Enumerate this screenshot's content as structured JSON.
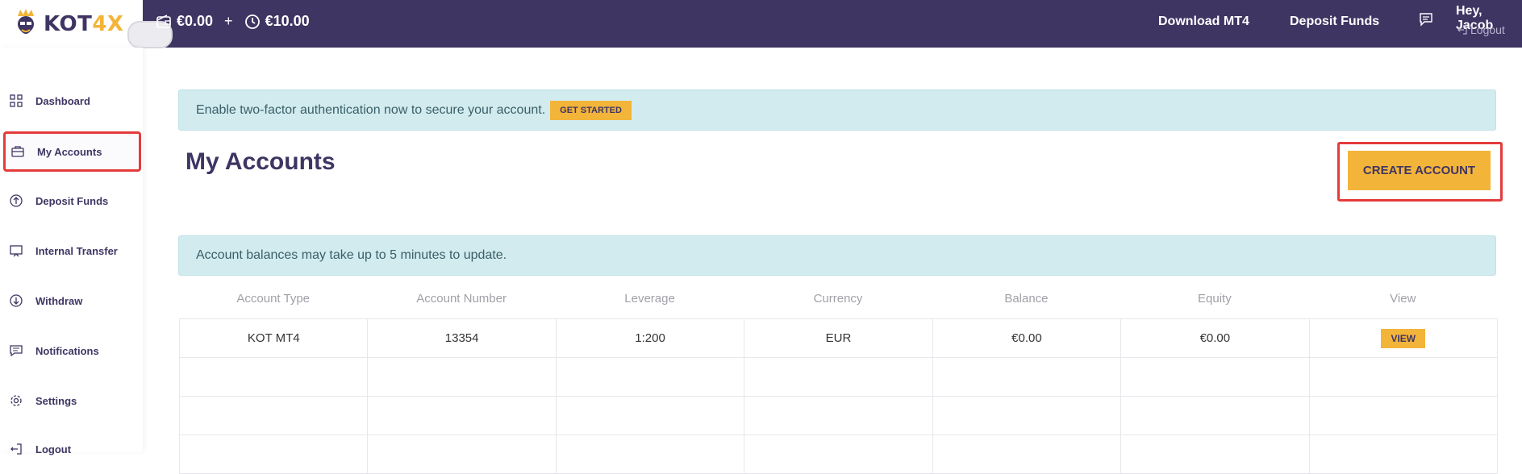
{
  "brand": {
    "logo_text_main": "KOT",
    "logo_text_accent": "4X"
  },
  "header": {
    "balance": "€0.00",
    "plus": "+",
    "bonus": "€10.00",
    "links": [
      "Download MT4",
      "Deposit Funds"
    ],
    "greeting": "Hey, Jacob",
    "logout": "Logout"
  },
  "sidebar": {
    "items": [
      {
        "label": "Dashboard",
        "icon": "grid-icon"
      },
      {
        "label": "My Accounts",
        "icon": "briefcase-icon",
        "active": true
      },
      {
        "label": "Deposit Funds",
        "icon": "arrow-up-circle-icon"
      },
      {
        "label": "Internal Transfer",
        "icon": "transfer-icon"
      },
      {
        "label": "Withdraw",
        "icon": "arrow-down-circle-icon"
      },
      {
        "label": "Notifications",
        "icon": "message-icon"
      },
      {
        "label": "Settings",
        "icon": "gear-icon"
      },
      {
        "label": "Logout",
        "icon": "logout-icon"
      }
    ]
  },
  "alerts": {
    "twofa_text": "Enable two-factor authentication now to secure your account.",
    "twofa_button": "GET STARTED",
    "balances_text": "Account balances may take up to 5 minutes to update."
  },
  "main": {
    "title": "My Accounts",
    "create_button": "CREATE ACCOUNT"
  },
  "table": {
    "headers": [
      "Account Type",
      "Account Number",
      "Leverage",
      "Currency",
      "Balance",
      "Equity",
      "View"
    ],
    "rows": [
      [
        "KOT MT4",
        "13354",
        "1:200",
        "EUR",
        "€0.00",
        "€0.00",
        "VIEW"
      ]
    ],
    "empty_rows": 3
  },
  "colors": {
    "primary": "#3f3563",
    "accent": "#f3b43a",
    "alert_bg": "#d2ebef",
    "highlight": "#e43b3b"
  }
}
